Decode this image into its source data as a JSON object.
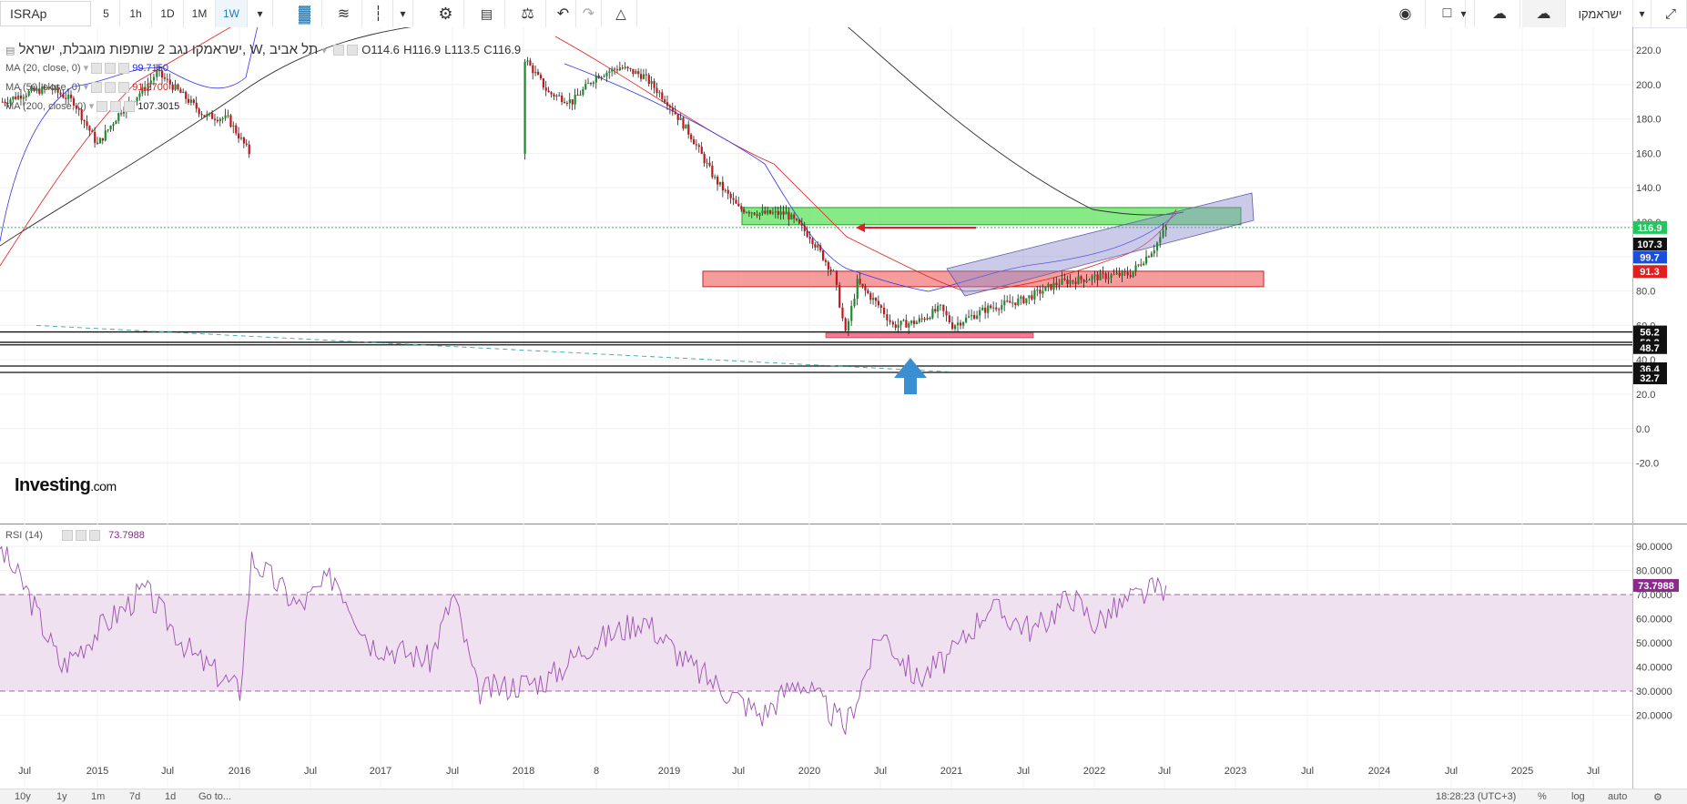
{
  "toolbar": {
    "symbol": "ISRAp",
    "intervals": [
      "5",
      "1h",
      "1D",
      "1M",
      "1W"
    ],
    "active_interval": "1W",
    "language_label": "ישראמקו"
  },
  "legend": {
    "title": "ישראמקו נגב 2 שותפות מוגבלת, ישראל, W, תל אביב",
    "open": "O114.6",
    "high": "H116.9",
    "low": "L113.5",
    "close": "C116.9",
    "indicators": [
      {
        "label": "MA (20, close, 0)",
        "value": "99.7150",
        "color": "#2a2ae0"
      },
      {
        "label": "MA (50, close, 0)",
        "value": "91.2700",
        "color": "#e02020"
      },
      {
        "label": "MA (200, close, 0)",
        "value": "107.3015",
        "color": "#222222"
      }
    ]
  },
  "price_axis": {
    "ticks": [
      220,
      200,
      180,
      160,
      140,
      120,
      100,
      80,
      60,
      40,
      20,
      0,
      -20
    ],
    "ticks_text": [
      "220.0",
      "200.0",
      "180.0",
      "160.0",
      "140.0",
      "120.0",
      "100.0",
      "80.0",
      "60.0",
      "40.0",
      "20.0",
      "0.0",
      "-20.0"
    ],
    "badges": [
      {
        "text": "116.9",
        "value": 116.9,
        "color": "#22c55e"
      },
      {
        "text": "107.3",
        "value": 107.3,
        "color": "#111111"
      },
      {
        "text": "99.7",
        "value": 99.7,
        "color": "#1d4ed8"
      },
      {
        "text": "91.3",
        "value": 91.3,
        "color": "#e02020"
      },
      {
        "text": "56.2",
        "value": 56.2,
        "color": "#111111"
      },
      {
        "text": "50.2",
        "value": 50.2,
        "color": "#111111"
      },
      {
        "text": "48.7",
        "value": 48.7,
        "color": "#111111"
      },
      {
        "text": "36.4",
        "value": 36.4,
        "color": "#111111"
      },
      {
        "text": "32.7",
        "value": 32.7,
        "color": "#111111"
      }
    ]
  },
  "rsi": {
    "label": "RSI (14)",
    "value": "73.7988",
    "ticks": [
      "90.0000",
      "80.0000",
      "70.0000",
      "60.0000",
      "50.0000",
      "40.0000",
      "30.0000",
      "20.0000"
    ],
    "upper": 70,
    "lower": 30
  },
  "time_axis": {
    "labels": [
      "Jul",
      "2015",
      "Jul",
      "2016",
      "Jul",
      "2017",
      "Jul",
      "2018",
      "8",
      "2019",
      "Jul",
      "2020",
      "Jul",
      "2021",
      "Jul",
      "2022",
      "Jul",
      "2023",
      "Jul",
      "2024",
      "Jul",
      "2025",
      "Jul"
    ]
  },
  "bottombar": {
    "ranges": [
      "10y",
      "1y",
      "1m",
      "7d",
      "1d",
      "Go to..."
    ],
    "time": "18:28:23 (UTC+3)",
    "percent": "%",
    "log": "log",
    "auto": "auto"
  },
  "brand": {
    "name": "Investing",
    "suffix": ".com"
  },
  "chart_data": {
    "type": "candlestick",
    "timeframe": "W",
    "ylim": [
      -25,
      228
    ],
    "last_close": 116.9,
    "price_path": [
      [
        "2014-05",
        190
      ],
      [
        "2014-07",
        195
      ],
      [
        "2014-09",
        198
      ],
      [
        "2014-11",
        190
      ],
      [
        "2015-01",
        165
      ],
      [
        "2015-03",
        185
      ],
      [
        "2015-05",
        198
      ],
      [
        "2015-06",
        207
      ],
      [
        "2015-08",
        195
      ],
      [
        "2015-10",
        182
      ],
      [
        "2015-12",
        180
      ],
      [
        "2016-02",
        158
      ],
      [
        "2018-01",
        215
      ],
      [
        "2018-03",
        195
      ],
      [
        "2018-05",
        190
      ],
      [
        "2018-07",
        205
      ],
      [
        "2018-09",
        210
      ],
      [
        "2018-11",
        205
      ],
      [
        "2019-01",
        190
      ],
      [
        "2019-03",
        170
      ],
      [
        "2019-05",
        145
      ],
      [
        "2019-07",
        128
      ],
      [
        "2019-09",
        125
      ],
      [
        "2019-11",
        125
      ],
      [
        "2020-01",
        112
      ],
      [
        "2020-03",
        90
      ],
      [
        "2020-04",
        55
      ],
      [
        "2020-05",
        85
      ],
      [
        "2020-07",
        70
      ],
      [
        "2020-08",
        60
      ],
      [
        "2020-10",
        62
      ],
      [
        "2020-12",
        70
      ],
      [
        "2021-01",
        60
      ],
      [
        "2021-04",
        70
      ],
      [
        "2021-07",
        75
      ],
      [
        "2021-10",
        85
      ],
      [
        "2022-01",
        88
      ],
      [
        "2022-04",
        90
      ],
      [
        "2022-06",
        105
      ],
      [
        "2022-07",
        116.9
      ]
    ],
    "ma20_last": 99.715,
    "ma50_last": 91.27,
    "ma200_last": 107.3015,
    "zones": [
      {
        "color": "green",
        "from": 119,
        "to": 129
      },
      {
        "color": "red",
        "from": 83,
        "to": 92
      }
    ],
    "horizontal_levels": [
      56.2,
      50.2,
      48.7,
      36.4,
      32.7,
      116.9
    ],
    "rsi_path": [
      [
        "2014-04",
        95
      ],
      [
        "2014-07",
        72
      ],
      [
        "2014-10",
        40
      ],
      [
        "2015-01",
        55
      ],
      [
        "2015-05",
        72
      ],
      [
        "2015-09",
        45
      ],
      [
        "2016-01",
        30
      ],
      [
        "2016-02",
        85
      ],
      [
        "2016-06",
        65
      ],
      [
        "2016-09",
        78
      ],
      [
        "2016-12",
        50
      ],
      [
        "2017-05",
        43
      ],
      [
        "2017-07",
        70
      ],
      [
        "2017-09",
        30
      ],
      [
        "2018-03",
        35
      ],
      [
        "2018-06",
        48
      ],
      [
        "2018-11",
        60
      ],
      [
        "2019-03",
        40
      ],
      [
        "2019-09",
        20
      ],
      [
        "2019-12",
        35
      ],
      [
        "2020-04",
        15
      ],
      [
        "2020-07",
        55
      ],
      [
        "2020-10",
        35
      ],
      [
        "2021-01",
        45
      ],
      [
        "2021-04",
        65
      ],
      [
        "2021-08",
        55
      ],
      [
        "2021-11",
        70
      ],
      [
        "2022-01",
        58
      ],
      [
        "2022-04",
        68
      ],
      [
        "2022-07",
        73.8
      ]
    ]
  }
}
